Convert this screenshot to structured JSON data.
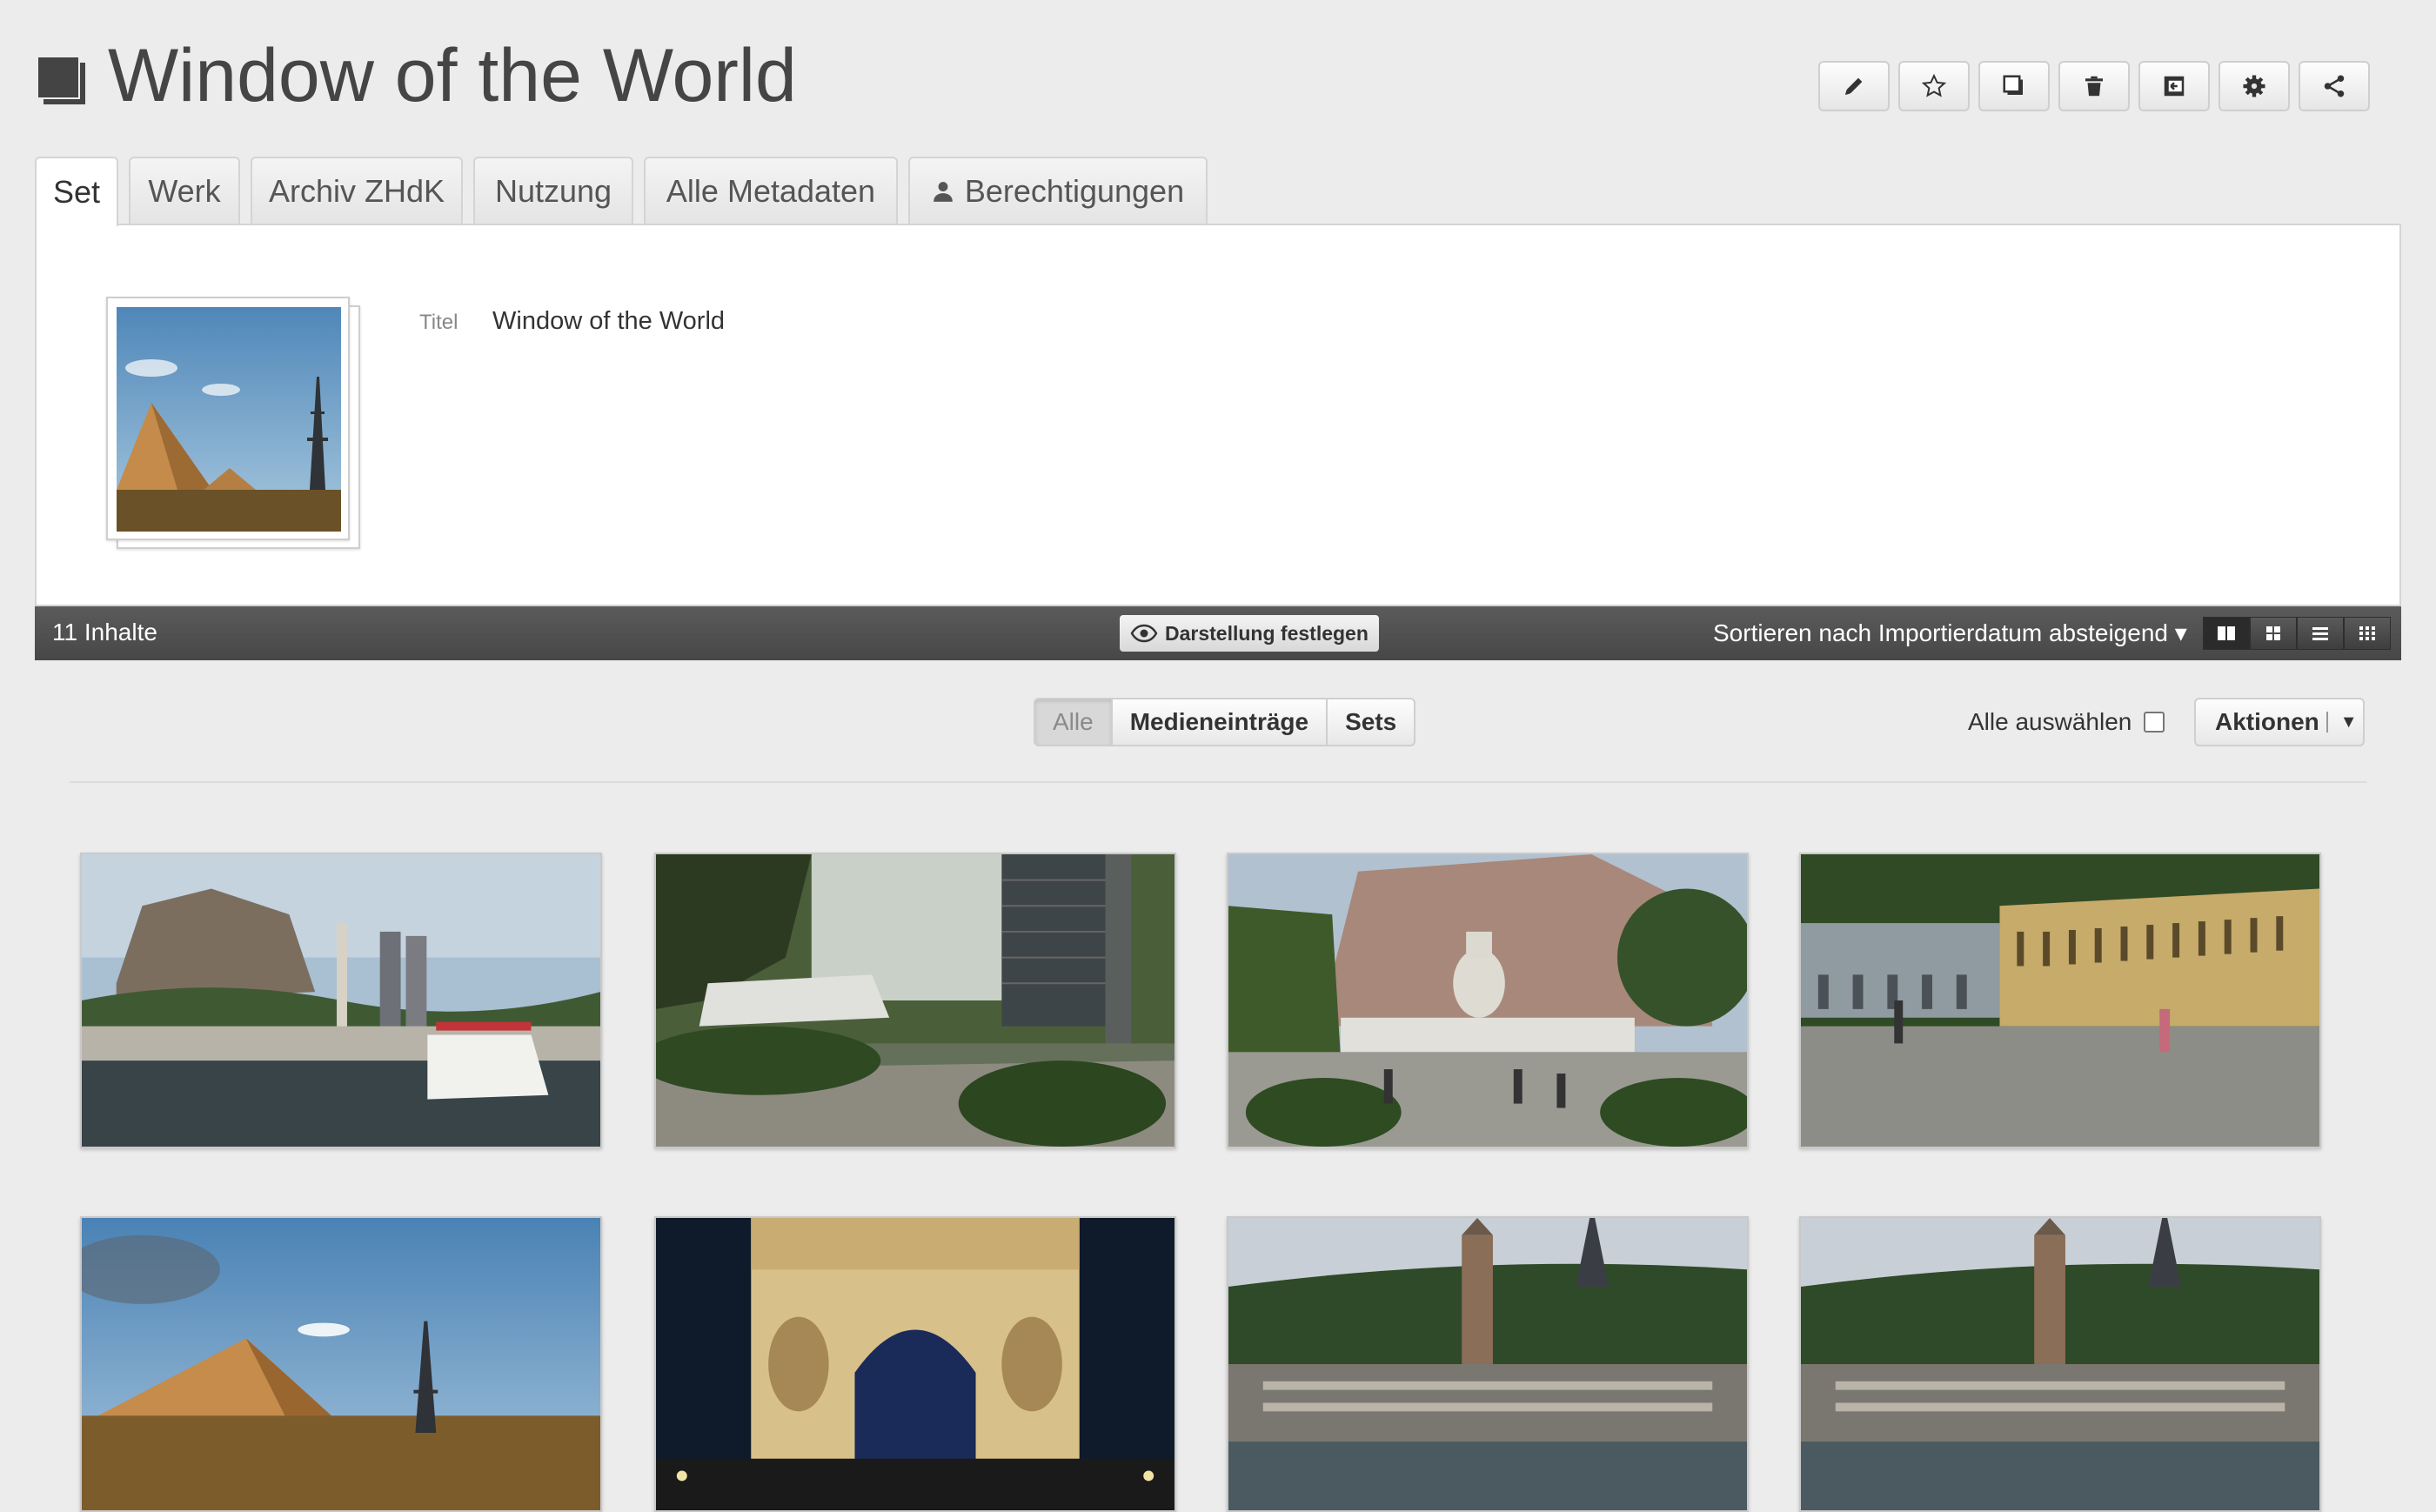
{
  "header": {
    "title": "Window of the World",
    "toolbar": [
      {
        "icon": "pencil-icon",
        "name": "edit-button"
      },
      {
        "icon": "star-icon",
        "name": "favorite-button"
      },
      {
        "icon": "set-icon",
        "name": "add-to-set-button"
      },
      {
        "icon": "trash-icon",
        "name": "delete-button"
      },
      {
        "icon": "transfer-icon",
        "name": "transfer-button"
      },
      {
        "icon": "gear-icon",
        "name": "settings-button"
      },
      {
        "icon": "share-icon",
        "name": "share-button"
      }
    ]
  },
  "tabs": [
    {
      "label": "Set",
      "active": true
    },
    {
      "label": "Werk",
      "active": false
    },
    {
      "label": "Archiv ZHdK",
      "active": false
    },
    {
      "label": "Nutzung",
      "active": false
    },
    {
      "label": "Alle Metadaten",
      "active": false
    },
    {
      "label": "Berechtigungen",
      "active": false,
      "icon": "person-icon"
    }
  ],
  "meta": {
    "title_label": "Titel",
    "title_value": "Window of the World"
  },
  "bar": {
    "count": "11 Inhalte",
    "layout_button": "Darstellung festlegen",
    "sort": "Sortieren nach Importierdatum absteigend ▾",
    "views": [
      "tiles-icon",
      "grid-icon",
      "list-icon",
      "miniature-icon"
    ],
    "active_view": "tiles-icon"
  },
  "filter": {
    "options": [
      "Alle",
      "Medieneinträge",
      "Sets"
    ],
    "active": "Alle",
    "select_all": "Alle auswählen",
    "actions": "Aktionen"
  },
  "colors": {
    "dark_bar": "#4f4f4f",
    "background": "#ececec"
  },
  "media": [
    {
      "scene": "castle-city-miniature-photo"
    },
    {
      "scene": "garden-skyscraper-photo"
    },
    {
      "scene": "capitol-miniature-photo"
    },
    {
      "scene": "courtyard-arcades-photo"
    },
    {
      "scene": "pyramid-eiffel-photo"
    },
    {
      "scene": "arc-de-triomphe-night-photo"
    },
    {
      "scene": "venice-eiffel-photo"
    },
    {
      "scene": "venice-eiffel-photo-2"
    }
  ]
}
